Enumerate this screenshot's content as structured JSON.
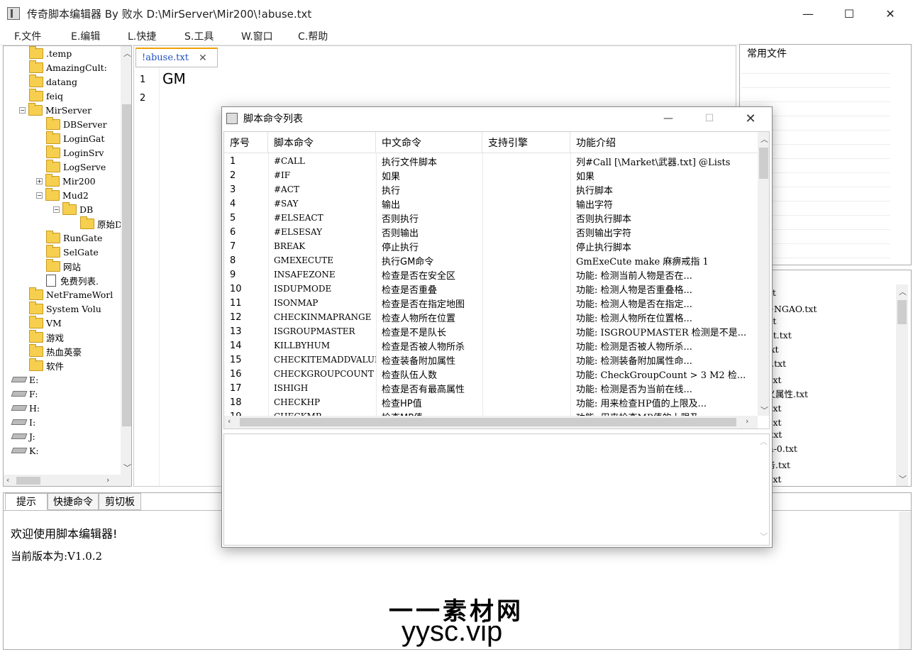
{
  "window": {
    "title": "传奇脚本编辑器  By  败水  D:\\MirServer\\Mir200\\!abuse.txt",
    "minimize": "—",
    "maximize": "☐",
    "close": "✕"
  },
  "menu": [
    "F.文件",
    "E.编辑",
    "L.快捷",
    "S.工具",
    "W.窗口",
    "C.帮助"
  ],
  "tree": {
    "nodes": [
      {
        "label": ".temp",
        "type": "folder"
      },
      {
        "label": "AmazingCult:",
        "type": "folder"
      },
      {
        "label": "datang",
        "type": "folder"
      },
      {
        "label": "feiq",
        "type": "folder"
      },
      {
        "label": "MirServer",
        "type": "folder",
        "toggle": "−"
      },
      {
        "label": "DBServer",
        "type": "folder"
      },
      {
        "label": "LoginGat",
        "type": "folder"
      },
      {
        "label": "LoginSrv",
        "type": "folder"
      },
      {
        "label": "LogServe",
        "type": "folder"
      },
      {
        "label": "Mir200",
        "type": "folder",
        "toggle": "+"
      },
      {
        "label": "Mud2",
        "type": "folder",
        "toggle": "−"
      },
      {
        "label": "DB",
        "type": "folder",
        "toggle": "−"
      },
      {
        "label": "原始D",
        "type": "folder"
      },
      {
        "label": "RunGate",
        "type": "folder"
      },
      {
        "label": "SelGate",
        "type": "folder"
      },
      {
        "label": "网站",
        "type": "folder"
      },
      {
        "label": "免费列表.",
        "type": "doc"
      },
      {
        "label": "NetFrameWorl",
        "type": "folder"
      },
      {
        "label": "System Volu",
        "type": "folder"
      },
      {
        "label": "VM",
        "type": "folder"
      },
      {
        "label": "游戏",
        "type": "folder"
      },
      {
        "label": "热血英豪",
        "type": "folder"
      },
      {
        "label": "软件",
        "type": "folder"
      },
      {
        "label": "E:",
        "type": "drive"
      },
      {
        "label": "F:",
        "type": "drive"
      },
      {
        "label": "H:",
        "type": "drive"
      },
      {
        "label": "I:",
        "type": "drive"
      },
      {
        "label": "J:",
        "type": "drive"
      },
      {
        "label": "K:",
        "type": "drive"
      }
    ]
  },
  "editor": {
    "tab_label": "!abuse.txt",
    "tab_close": "✕",
    "line_numbers": [
      "1",
      "2"
    ],
    "line1": "GM"
  },
  "favorites": {
    "title": "常用文件"
  },
  "recent": {
    "title": "文件",
    "items": [
      "buse.txt",
      "送服务~NGAO.txt",
      "story.txt",
      "bindList.txt",
      "nGen.txt",
      "rChant.txt",
      "陆脚本.txt",
      "启自定义属性.txt",
      "就系统.txt",
      "置按钮.txt",
      "anage.txt",
      "unction-0.txt",
      "护者服务.txt",
      "炎蛛王.txt"
    ]
  },
  "bottom": {
    "tabs": [
      "提示",
      "快捷命令",
      "剪切板"
    ],
    "line1": "欢迎使用脚本编辑器!",
    "line2": "当前版本为:V1.0.2"
  },
  "dialog": {
    "title": "脚本命令列表",
    "headers": [
      "序号",
      "脚本命令",
      "中文命令",
      "支持引擎",
      "功能介绍"
    ],
    "rows": [
      [
        "1",
        "#CALL",
        "执行文件脚本",
        "",
        "列#Call [\\Market\\武器.txt] @Lists"
      ],
      [
        "2",
        "#IF",
        "如果",
        "",
        "如果"
      ],
      [
        "3",
        "#ACT",
        "执行",
        "",
        "执行脚本"
      ],
      [
        "4",
        "#SAY",
        "输出",
        "",
        "输出字符"
      ],
      [
        "5",
        "#ELSEACT",
        "否则执行",
        "",
        "否则执行脚本"
      ],
      [
        "6",
        "#ELSESAY",
        "否则输出",
        "",
        "否则输出字符"
      ],
      [
        "7",
        "BREAK",
        "停止执行",
        "",
        "停止执行脚本"
      ],
      [
        "8",
        "GMEXECUTE",
        "执行GM命令",
        "",
        "GmExeCute make 麻痹戒指 1"
      ],
      [
        "9",
        "INSAFEZONE",
        "检查是否在安全区",
        "",
        "功能:      检测当前人物是否在..."
      ],
      [
        "10",
        "ISDUPMODE",
        "检查是否重叠",
        "",
        "功能:      检测人物是否重叠格..."
      ],
      [
        "11",
        "ISONMAP",
        "检查是否在指定地图",
        "",
        "功能:      检测人物是否在指定..."
      ],
      [
        "12",
        "CHECKINMAPRANGE",
        "检查人物所在位置",
        "",
        "功能:      检测人物所在位置格..."
      ],
      [
        "13",
        "ISGROUPMASTER",
        "检查是不是队长",
        "",
        "功能: ISGROUPMASTER 检测是不是..."
      ],
      [
        "14",
        "KILLBYHUM",
        "检查是否被人物所杀",
        "",
        "功能:      检测是否被人物所杀..."
      ],
      [
        "15",
        "CHECKITEMADDVALUE",
        "检查装备附加属性",
        "",
        "功能:      检测装备附加属性命..."
      ],
      [
        "16",
        "CHECKGROUPCOUNT",
        "检查队伍人数",
        "",
        "功能: CheckGroupCount > 3 M2 检..."
      ],
      [
        "17",
        "ISHIGH",
        "检查是否有最高属性",
        "",
        "功能:      检测是否为当前在线..."
      ],
      [
        "18",
        "CHECKHP",
        "检查HP值",
        "",
        "功能:    用来检查HP值的上限及..."
      ],
      [
        "19",
        "CHECKMP",
        "检查MP值",
        "",
        "功能:    用来检查MP值的上限及..."
      ]
    ]
  },
  "watermark": {
    "line1": "一一素材网",
    "line2": "yysc.vip"
  }
}
